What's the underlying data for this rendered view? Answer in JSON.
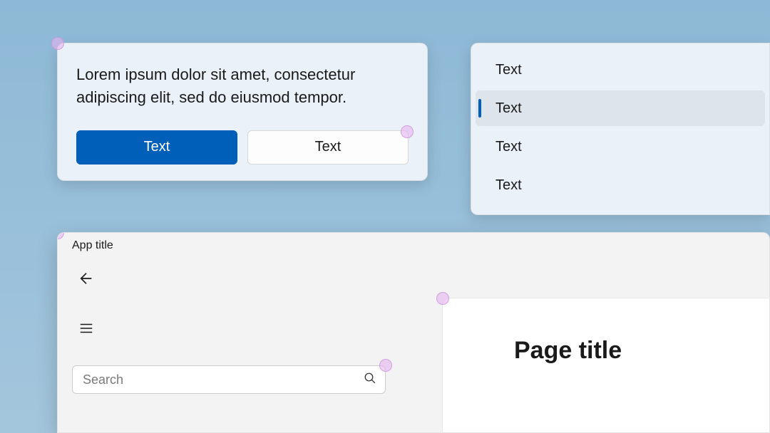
{
  "dialog": {
    "body_text": "Lorem ipsum dolor sit amet, consectetur adipiscing elit, sed do eiusmod tempor.",
    "primary_button_label": "Text",
    "secondary_button_label": "Text"
  },
  "list": {
    "items": [
      {
        "label": "Text",
        "selected": false
      },
      {
        "label": "Text",
        "selected": true
      },
      {
        "label": "Text",
        "selected": false
      },
      {
        "label": "Text",
        "selected": false
      }
    ]
  },
  "app": {
    "title": "App title",
    "search_placeholder": "Search",
    "page_title": "Page title"
  },
  "colors": {
    "accent": "#005fb8",
    "card_bg": "#eaf1f8",
    "chrome_bg": "#f3f3f3"
  }
}
